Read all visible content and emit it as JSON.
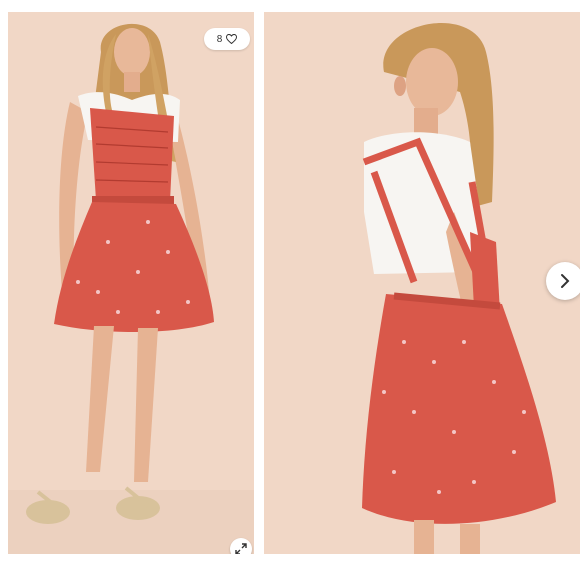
{
  "gallery": {
    "like_count": "8",
    "heart_icon": "heart-outline-icon",
    "expand_icon": "expand-arrows-icon",
    "next_icon": "chevron-right-icon"
  },
  "colors": {
    "backdrop": "#f1d7c6",
    "dress": "#d9584a",
    "shirt": "#f7f5f2"
  }
}
